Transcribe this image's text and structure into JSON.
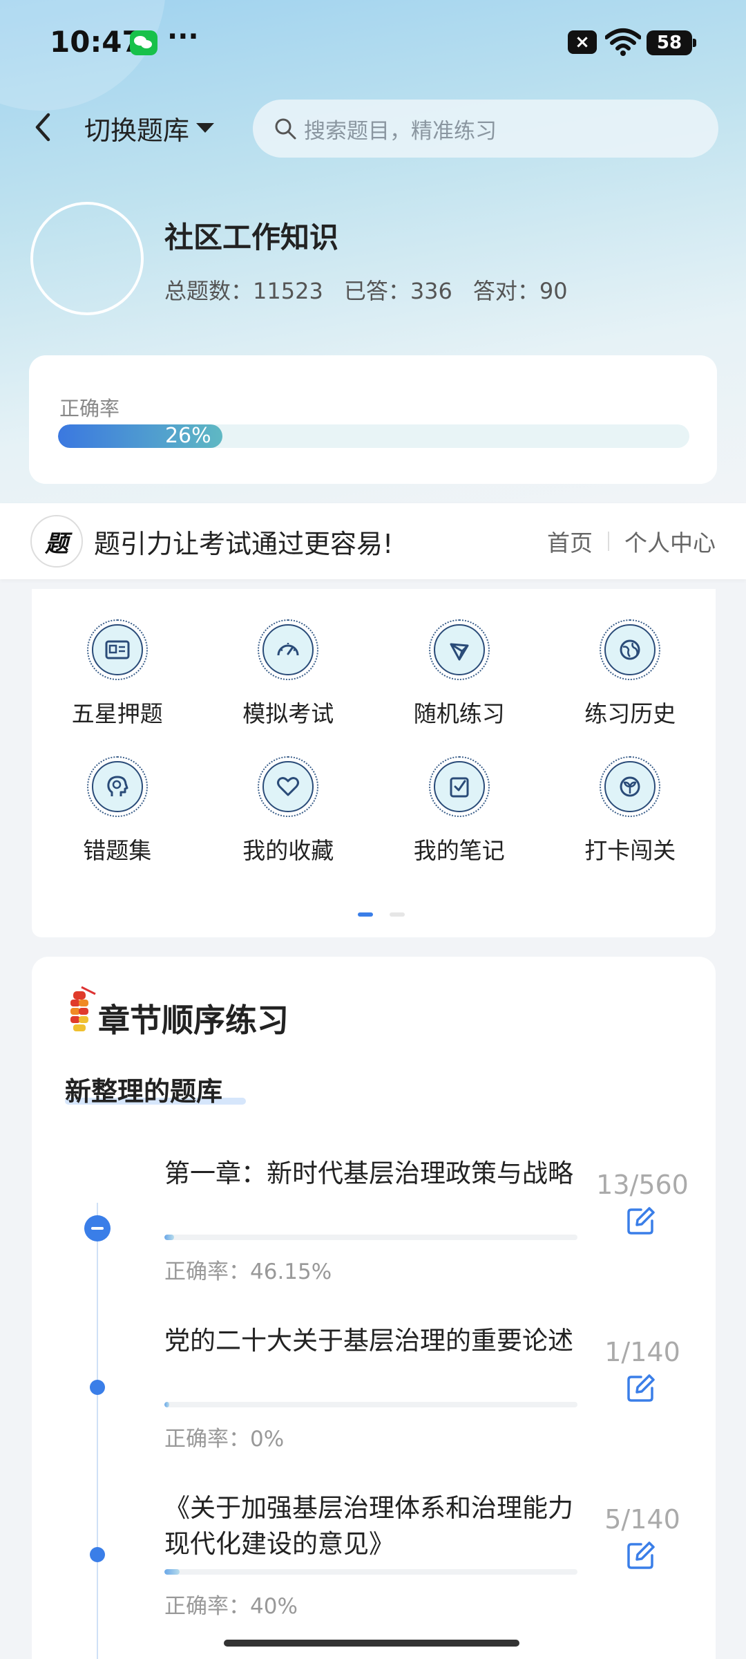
{
  "status_bar": {
    "time": "10:47",
    "more": "···",
    "battery": "58",
    "icons": [
      "wechat-icon",
      "sim-x-icon",
      "wifi-icon",
      "battery-icon"
    ]
  },
  "nav": {
    "switch_bank_label": "切换题库",
    "search_placeholder": "搜索题目，精准练习"
  },
  "profile": {
    "bank_name": "社区工作知识",
    "total": "总题数：11523",
    "answered": "已答：336",
    "correct": "答对：90"
  },
  "accuracy": {
    "label": "正确率",
    "value_text": "26%",
    "value": 0.26
  },
  "banner": {
    "logo_text": "题",
    "slogan": "题引力让考试通过更容易!",
    "home_link": "首页",
    "personal_link": "个人中心"
  },
  "functions": [
    {
      "label": "五星押题",
      "icon": "id-card-icon"
    },
    {
      "label": "模拟考试",
      "icon": "speedometer-icon"
    },
    {
      "label": "随机练习",
      "icon": "network-icon"
    },
    {
      "label": "练习历史",
      "icon": "globe-icon"
    },
    {
      "label": "错题集",
      "icon": "head-icon"
    },
    {
      "label": "我的收藏",
      "icon": "heart-icon"
    },
    {
      "label": "我的笔记",
      "icon": "note-check-icon"
    },
    {
      "label": "打卡闯关",
      "icon": "sprout-icon"
    }
  ],
  "chapters": {
    "section_title": "章节顺序练习",
    "subbank_title": "新整理的题库",
    "items": [
      {
        "name": "第一章：新时代基层治理政策与战略",
        "accuracy": "正确率：46.15%",
        "count": "13/560",
        "progress": 0.023
      },
      {
        "name": "党的二十大关于基层治理的重要论述",
        "accuracy": "正确率：0%",
        "count": "1/140",
        "progress": 0.007
      },
      {
        "name": "《关于加强基层治理体系和治理能力现代化建设的意见》",
        "accuracy": "正确率：40%",
        "count": "5/140",
        "progress": 0.036
      }
    ]
  },
  "colors": {
    "accent": "#3a7ee8",
    "accuracy_gradient_start": "#3b78e0",
    "accuracy_gradient_end": "#5fb8c3"
  }
}
